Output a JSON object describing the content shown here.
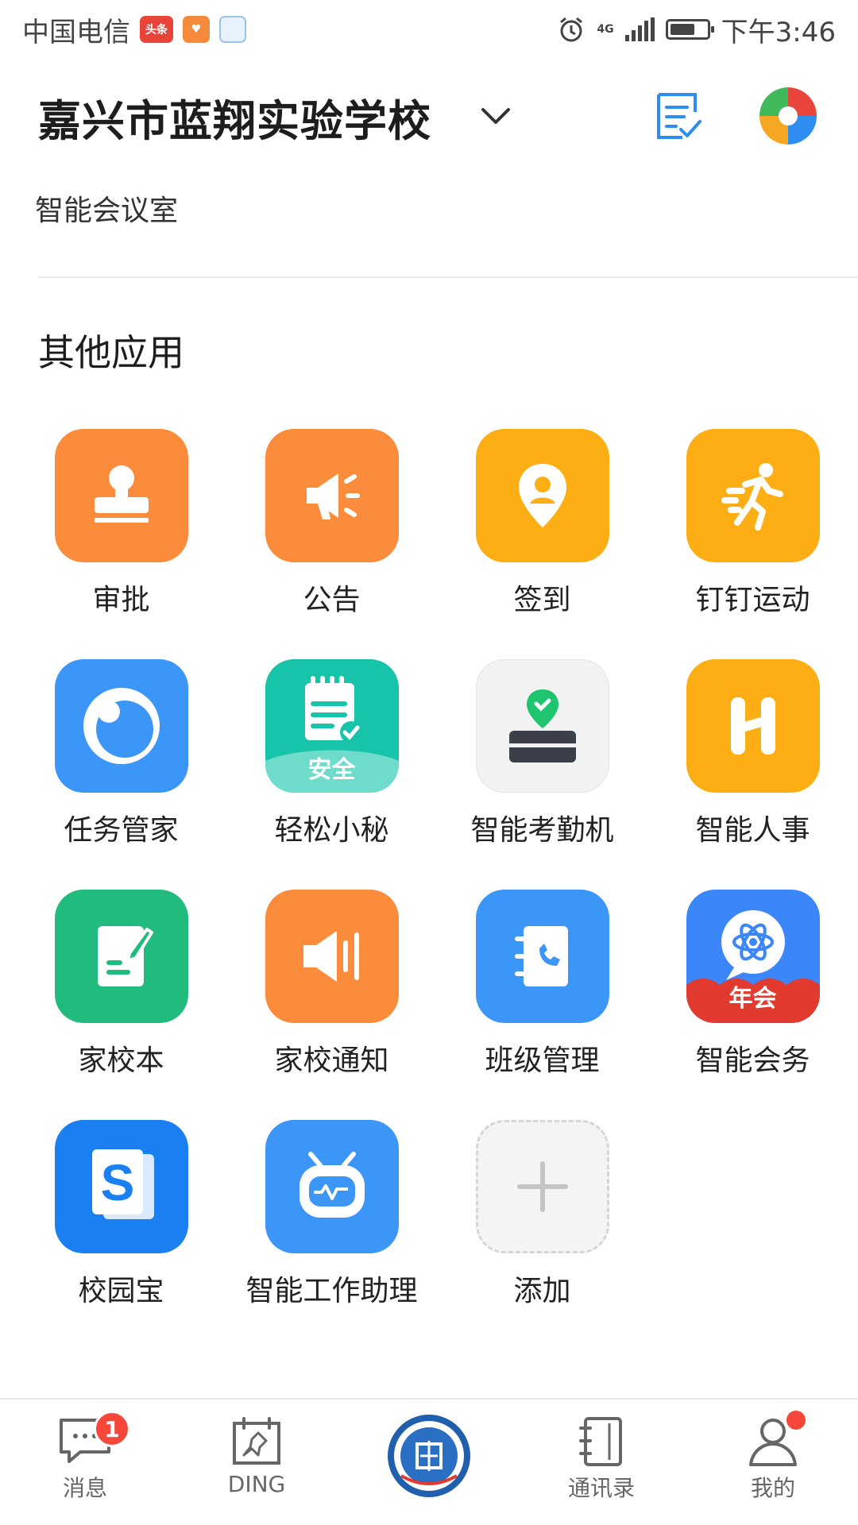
{
  "status_bar": {
    "carrier": "中国电信",
    "toutiao_badge": "头条",
    "network": "4G",
    "time": "下午3:46"
  },
  "header": {
    "org_name": "嘉兴市蓝翔实验学校",
    "subtitle": "智能会议室"
  },
  "section": {
    "title": "其他应用"
  },
  "apps": [
    {
      "label": "审批",
      "color": "#fb8c3c",
      "icon": "stamp-icon"
    },
    {
      "label": "公告",
      "color": "#fb8c3c",
      "icon": "megaphone-icon"
    },
    {
      "label": "签到",
      "color": "#fdae14",
      "icon": "location-pin-icon"
    },
    {
      "label": "钉钉运动",
      "color": "#fdae14",
      "icon": "running-icon"
    },
    {
      "label": "任务管家",
      "color": "#3b96f8",
      "icon": "eye-icon"
    },
    {
      "label": "轻松小秘",
      "color": "#17c3a9",
      "icon": "notepad-icon",
      "badge_text": "安全"
    },
    {
      "label": "智能考勤机",
      "color": "#f2f2f2",
      "icon": "attendance-machine-icon"
    },
    {
      "label": "智能人事",
      "color": "#fdae14",
      "icon": "h-letter-icon"
    },
    {
      "label": "家校本",
      "color": "#21bb7e",
      "icon": "notebook-pen-icon"
    },
    {
      "label": "家校通知",
      "color": "#fb8c3c",
      "icon": "loudspeaker-icon"
    },
    {
      "label": "班级管理",
      "color": "#3b96f8",
      "icon": "phonebook-icon"
    },
    {
      "label": "智能会务",
      "color": "#3b86f8",
      "icon": "atom-chat-icon",
      "badge_text": "年会"
    },
    {
      "label": "校园宝",
      "color": "#1a7ff0",
      "icon": "s-book-icon"
    },
    {
      "label": "智能工作助理",
      "color": "#3b96f8",
      "icon": "robot-icon"
    },
    {
      "label": "添加",
      "color": "#f4f4f4",
      "icon": "plus-icon"
    }
  ],
  "tabbar": {
    "messages_label": "消息",
    "messages_badge": "1",
    "ding_label": "DING",
    "contacts_label": "通讯录",
    "me_label": "我的"
  }
}
